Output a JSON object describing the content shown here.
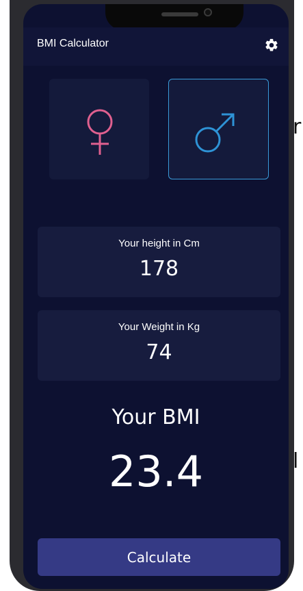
{
  "app": {
    "title": "BMI Calculator",
    "settings_icon": "gear-icon"
  },
  "gender": {
    "female_icon": "female-symbol-icon",
    "male_icon": "male-symbol-icon",
    "selected": "male"
  },
  "height": {
    "label": "Your height in Cm",
    "value": "178"
  },
  "weight": {
    "label": "Your Weight in Kg",
    "value": "74"
  },
  "result": {
    "heading": "Your BMI",
    "value": "23.4"
  },
  "actions": {
    "calculate_label": "Calculate"
  },
  "colors": {
    "background": "#0d1131",
    "card": "#171c3e",
    "female_accent": "#e0608f",
    "male_accent": "#2e93d6",
    "button": "#353a85"
  }
}
